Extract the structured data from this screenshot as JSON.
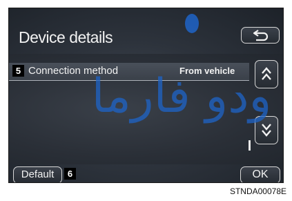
{
  "screen": {
    "title": "Device details",
    "rows": [
      {
        "badge": "5",
        "label": "Connection method",
        "value": "From vehicle"
      }
    ],
    "scroll": {
      "position": 0.85
    },
    "buttons": {
      "back_icon": "back-arrow-icon",
      "page_up_icon": "double-chevron-up-icon",
      "page_down_icon": "double-chevron-down-icon",
      "default_label": "Default",
      "default_badge": "6",
      "ok_label": "OK"
    }
  },
  "watermark": {
    "text": "ودو فارما",
    "color": "#1e64c8"
  },
  "figure_code": "STNDA00078E"
}
